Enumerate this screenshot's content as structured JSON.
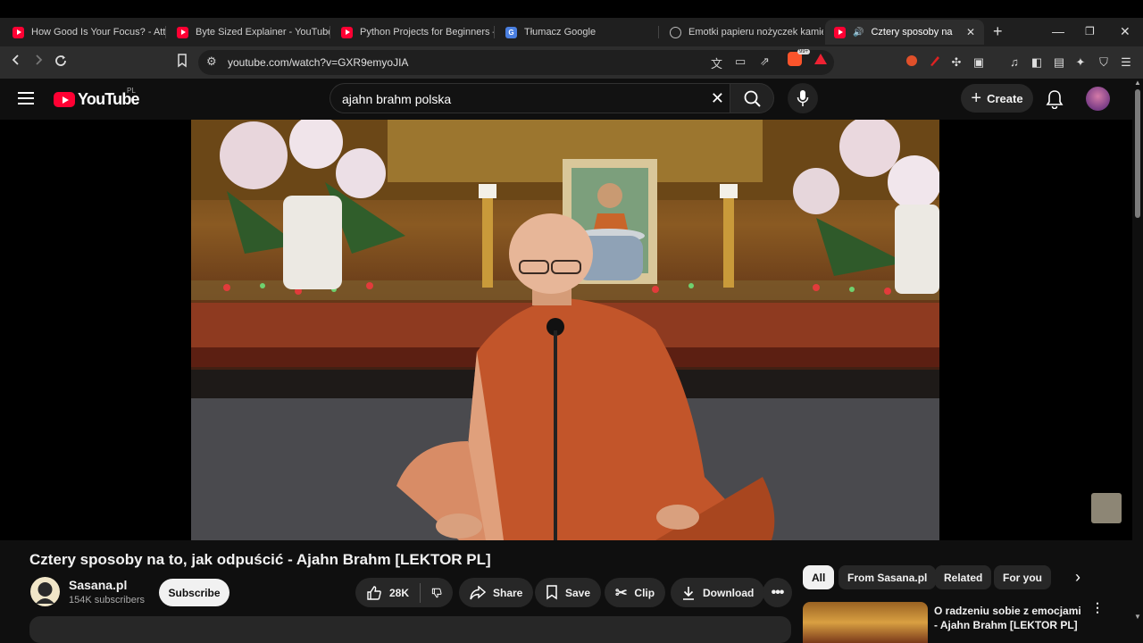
{
  "browser": {
    "tabs": [
      {
        "title": "How Good Is Your Focus? - Atte",
        "icon": "youtube-icon",
        "active": false
      },
      {
        "title": "Byte Sized Explainer - YouTube",
        "icon": "youtube-icon",
        "active": false
      },
      {
        "title": "Python Projects for Beginners –",
        "icon": "youtube-icon",
        "active": false
      },
      {
        "title": "Tłumacz Google",
        "icon": "google-translate-icon",
        "active": false
      },
      {
        "title": "Emotki papieru nożyczek kamie",
        "icon": "globe-icon",
        "active": false
      },
      {
        "title": "Cztery sposoby na to, jak",
        "icon": "youtube-icon",
        "active": true
      }
    ],
    "new_tab": "+",
    "url": "youtube.com/watch?v=GXR9emyoJIA",
    "brave_badge": "99+"
  },
  "youtube": {
    "logo_text": "YouTube",
    "country_code": "PL",
    "search_value": "ajahn brahm polska",
    "create_label": "Create"
  },
  "video": {
    "title": "Cztery sposoby na to, jak odpuścić - Ajahn Brahm [LEKTOR PL]",
    "channel_name": "Sasana.pl",
    "channel_subs": "154K subscribers",
    "subscribe_label": "Subscribe",
    "likes": "28K",
    "share_label": "Share",
    "save_label": "Save",
    "clip_label": "Clip",
    "download_label": "Download"
  },
  "sidebar": {
    "chips": [
      "All",
      "From Sasana.pl",
      "Related",
      "For you"
    ],
    "related": [
      {
        "title": "O radzeniu sobie z emocjami - Ajahn Brahm [LEKTOR PL]"
      }
    ]
  },
  "colors": {
    "accent_red": "#ff0033",
    "background": "#0f0f0f",
    "chip_bg": "#272727"
  }
}
